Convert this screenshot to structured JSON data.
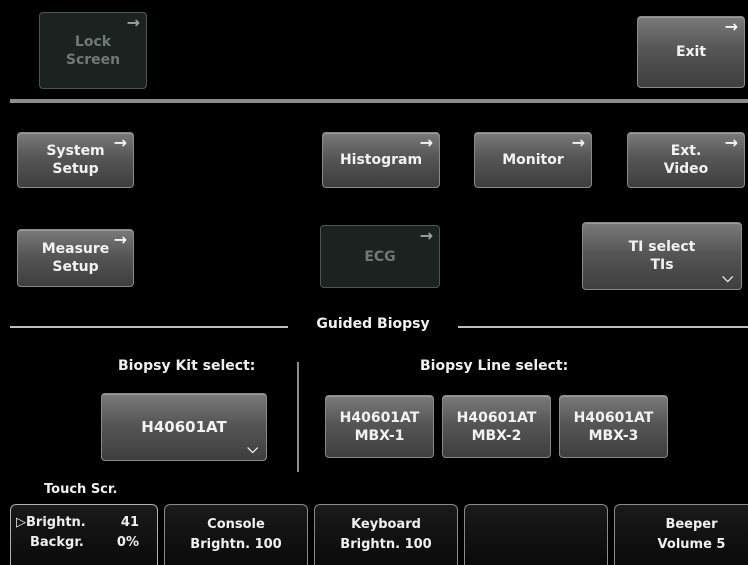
{
  "top": {
    "lock_screen": "Lock\nScreen",
    "exit": "Exit"
  },
  "buttons": {
    "system_setup": "System\nSetup",
    "histogram": "Histogram",
    "monitor": "Monitor",
    "ext_video": "Ext.\nVideo",
    "measure_setup": "Measure\nSetup",
    "ecg": "ECG",
    "ti_select": "TI select\nTIs"
  },
  "biopsy": {
    "section_title": "Guided Biopsy",
    "kit_label": "Biopsy Kit select:",
    "kit_value": "H40601AT",
    "line_label": "Biopsy Line select:",
    "lines": [
      "H40601AT\nMBX-1",
      "H40601AT\nMBX-2",
      "H40601AT\nMBX-3"
    ]
  },
  "bottom": {
    "touch_label": "Touch Scr.",
    "touch_brightness_label": "▷Brightn.",
    "touch_brightness_value": "41",
    "touch_background_label": "Backgr.",
    "touch_background_value": "0%",
    "console": "Console\nBrightn.  100",
    "keyboard": "Keyboard\nBrightn.  100",
    "beeper": "Beeper\nVolume  5"
  },
  "icons": {
    "arrow": "arrow-right-icon",
    "chevron": "chevron-down-icon"
  },
  "colors": {
    "background": "#000000",
    "button": "#565656",
    "disabled_button": "#1b221f",
    "text": "#f0f0f0"
  }
}
